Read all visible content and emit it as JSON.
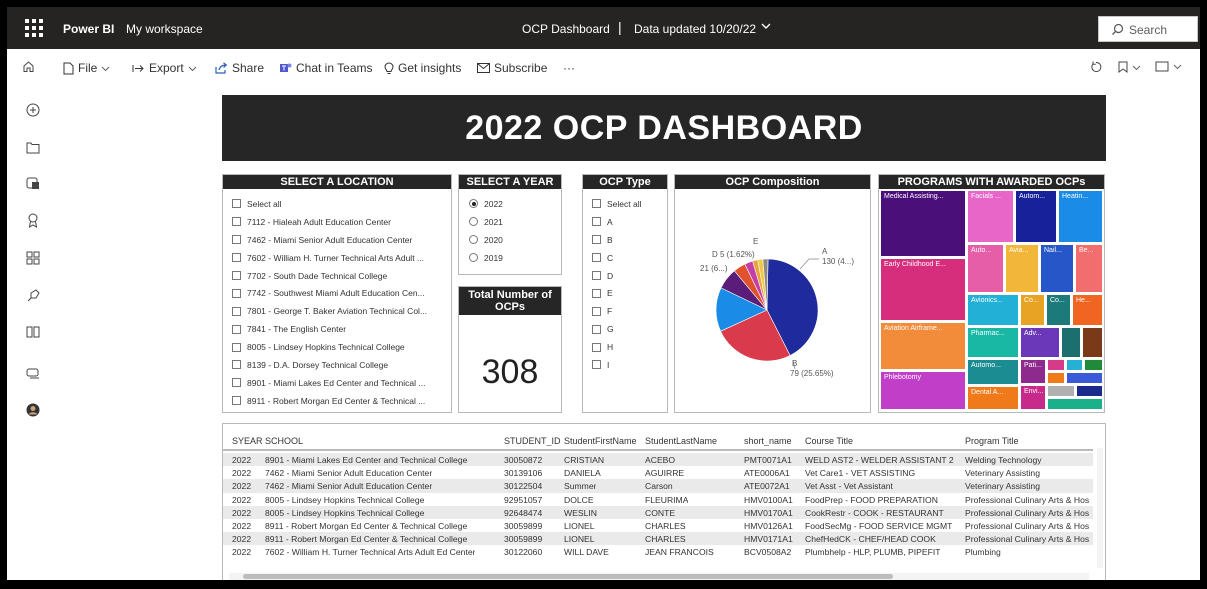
{
  "topbar": {
    "app_name": "Power BI",
    "workspace": "My workspace",
    "report_title": "OCP Dashboard",
    "separator": "|",
    "data_updated": "Data updated 10/20/22",
    "search_placeholder": "Search"
  },
  "toolbar": {
    "file": "File",
    "export": "Export",
    "share": "Share",
    "chat": "Chat in Teams",
    "insights": "Get insights",
    "subscribe": "Subscribe",
    "more": "···"
  },
  "dashboard": {
    "title": "2022 OCP DASHBOARD"
  },
  "location_slicer": {
    "title": "SELECT A LOCATION",
    "items": [
      "Select all",
      "7112 - Hialeah Adult Education Center",
      "7462 - Miami Senior Adult Education Center",
      "7602 - William H. Turner Technical Arts Adult ...",
      "7702 - South Dade Technical College",
      "7742 - Southwest Miami Adult Education Cen...",
      "7801 - George T. Baker Aviation Technical Col...",
      "7841 - The English Center",
      "8005 - Lindsey Hopkins Technical College",
      "8139 - D.A. Dorsey Technical College",
      "8901 - Miami Lakes Ed Center and Technical ...",
      "8911 - Robert Morgan Ed Center & Technical ..."
    ]
  },
  "year_slicer": {
    "title": "SELECT A YEAR",
    "selected": "2022",
    "items": [
      "2022",
      "2021",
      "2020",
      "2019"
    ]
  },
  "total_card": {
    "title": "Total Number of OCPs",
    "value": "308"
  },
  "type_slicer": {
    "title": "OCP Type",
    "items": [
      "Select all",
      "A",
      "B",
      "C",
      "D",
      "E",
      "F",
      "G",
      "H",
      "I"
    ]
  },
  "composition": {
    "title": "OCP Composition",
    "labels": {
      "a_name": "A",
      "a_value": "130 (4...)",
      "b_name": "B",
      "b_value": "79 (25.65%)",
      "d": "D 5 (1.62%)",
      "e": "E",
      "other": "21 (6...)"
    }
  },
  "chart_data": {
    "type": "pie",
    "title": "OCP Composition",
    "slices": [
      {
        "name": "A",
        "value": 130,
        "color": "#1f2b9c"
      },
      {
        "name": "B",
        "value": 79,
        "color": "#d93a4c"
      },
      {
        "name": "C",
        "value": 43,
        "color": "#1a8ce8"
      },
      {
        "name": "",
        "value": 21,
        "color": "#5a1e7a"
      },
      {
        "name": "",
        "value": 12,
        "color": "#e0522e"
      },
      {
        "name": "",
        "value": 8,
        "color": "#c53da6"
      },
      {
        "name": "E",
        "value": 5,
        "color": "#e8a33a"
      },
      {
        "name": "D",
        "value": 5,
        "color": "#f2c744"
      },
      {
        "name": "",
        "value": 5,
        "color": "#8a8a8a"
      }
    ]
  },
  "programs": {
    "title": "PROGRAMS WITH AWARDED OCPs",
    "tiles": [
      {
        "label": "Medical Assisting...",
        "color": "#4b0f7a"
      },
      {
        "label": "Facials ...",
        "color": "#e866c8"
      },
      {
        "label": "Autom...",
        "color": "#17229a"
      },
      {
        "label": "Heatin...",
        "color": "#1a8ce8"
      },
      {
        "label": "Early Childhood E...",
        "color": "#d62e7c"
      },
      {
        "label": "Auto...",
        "color": "#e65ea7"
      },
      {
        "label": "Avia...",
        "color": "#f2b63a"
      },
      {
        "label": "Nail...",
        "color": "#2656c8"
      },
      {
        "label": "Be...",
        "color": "#f26d6d"
      },
      {
        "label": "Aviation Airframe...",
        "color": "#f28c3a"
      },
      {
        "label": "Avionics...",
        "color": "#22b0d6"
      },
      {
        "label": "Co...",
        "color": "#e8a324"
      },
      {
        "label": "Co...",
        "color": "#1c7a7a"
      },
      {
        "label": "He...",
        "color": "#f06522"
      },
      {
        "label": "Pharmac...",
        "color": "#18b8a5"
      },
      {
        "label": "Adv...",
        "color": "#6a38b8"
      },
      {
        "label": "Phlebotomy",
        "color": "#c03ec8"
      },
      {
        "label": "Automo...",
        "color": "#1b8d92"
      },
      {
        "label": "Pati...",
        "color": "#8e2a8e"
      },
      {
        "label": "Dental A...",
        "color": "#f07a1a"
      },
      {
        "label": "Envi...",
        "color": "#c82a8c"
      }
    ]
  },
  "table": {
    "headers": [
      "SYEAR",
      "SCHOOL",
      "STUDENT_ID",
      "StudentFirstName",
      "StudentLastName",
      "short_name",
      "Course Title",
      "Program Title"
    ],
    "rows": [
      [
        "2022",
        "8901 - Miami Lakes Ed Center and Technical College",
        "30050872",
        "CRISTIAN",
        "ACEBO",
        "PMT0071A1",
        "WELD AST2 - WELDER ASSISTANT 2",
        "Welding Technology"
      ],
      [
        "2022",
        "7462 - Miami Senior Adult Education Center",
        "30139106",
        "DANIELA",
        "AGUIRRE",
        "ATE0006A1",
        "Vet Care1 - VET ASSISTING",
        "Veterinary Assisting"
      ],
      [
        "2022",
        "7462 - Miami Senior Adult Education Center",
        "30122504",
        "Summer",
        "Carson",
        "ATE0072A1",
        "Vet Asst - Vet Assistant",
        "Veterinary Assisting"
      ],
      [
        "2022",
        "8005 - Lindsey Hopkins Technical College",
        "92951057",
        "DOLCE",
        "FLEURIMA",
        "HMV0100A1",
        "FoodPrep - FOOD PREPARATION",
        "Professional Culinary Arts & Hos"
      ],
      [
        "2022",
        "8005 - Lindsey Hopkins Technical College",
        "92648474",
        "WESLIN",
        "CONTE",
        "HMV0170A1",
        "CookRestr - COOK - RESTAURANT",
        "Professional Culinary Arts & Hos"
      ],
      [
        "2022",
        "8911 - Robert Morgan Ed Center & Technical College",
        "30059899",
        "LIONEL",
        "CHARLES",
        "HMV0126A1",
        "FoodSecMg - FOOD SERVICE MGMT",
        "Professional Culinary Arts & Hos"
      ],
      [
        "2022",
        "8911 - Robert Morgan Ed Center & Technical College",
        "30059899",
        "LIONEL",
        "CHARLES",
        "HMV0171A1",
        "ChefHedCK - CHEF/HEAD COOK",
        "Professional Culinary Arts & Hos"
      ],
      [
        "2022",
        "7602 - William H. Turner Technical Arts Adult Ed Center",
        "30122060",
        "WILL DAVE",
        "JEAN FRANCOIS",
        "BCV0508A2",
        "Plumbhelp - HLP, PLUMB, PIPEFIT",
        "Plumbing"
      ]
    ]
  }
}
